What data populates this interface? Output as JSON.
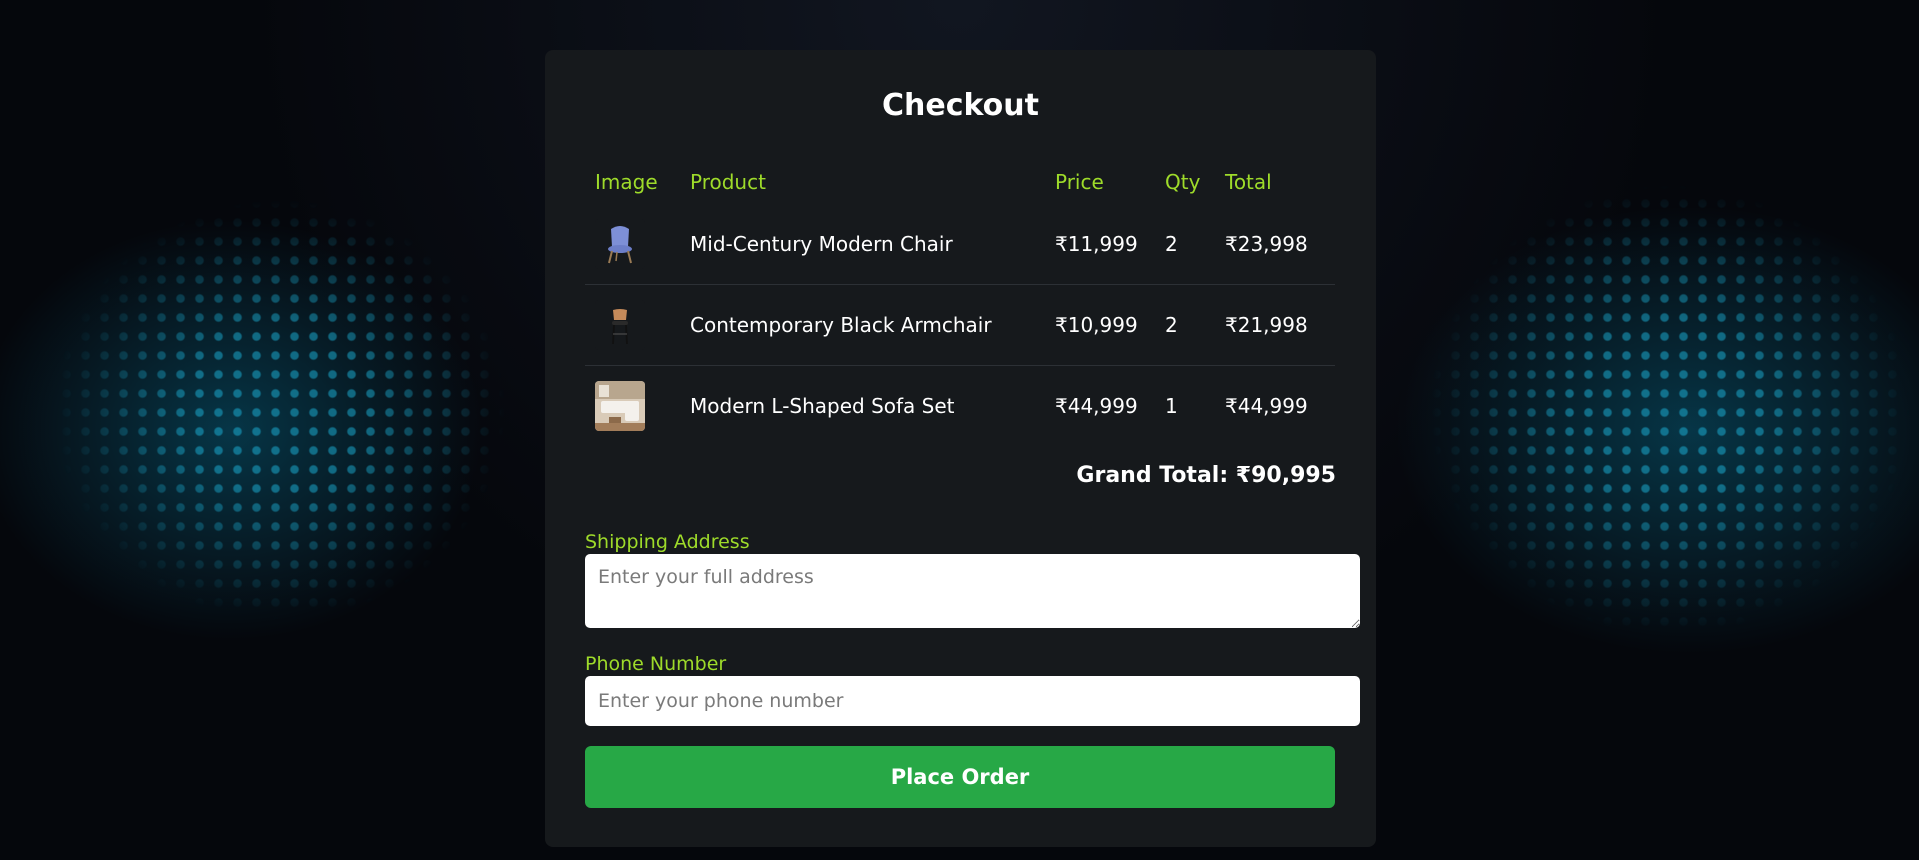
{
  "checkout": {
    "title": "Checkout",
    "table": {
      "headers": [
        "Image",
        "Product",
        "Price",
        "Qty",
        "Total"
      ],
      "rows": [
        {
          "image": "blue-chair-thumbnail",
          "product": "Mid-Century Modern Chair",
          "price": "₹11,999",
          "qty": "2",
          "total": "₹23,998"
        },
        {
          "image": "black-armchair-thumbnail",
          "product": "Contemporary Black Armchair",
          "price": "₹10,999",
          "qty": "2",
          "total": "₹21,998"
        },
        {
          "image": "sofa-set-thumbnail",
          "product": "Modern L-Shaped Sofa Set",
          "price": "₹44,999",
          "qty": "1",
          "total": "₹44,999"
        }
      ]
    },
    "grand_total": "Grand Total: ₹90,995",
    "shipping": {
      "label": "Shipping Address",
      "placeholder": "Enter your full address",
      "value": ""
    },
    "phone": {
      "label": "Phone Number",
      "placeholder": "Enter your phone number",
      "value": ""
    },
    "place_order_label": "Place Order"
  },
  "colors": {
    "accent_label": "#9edb2a",
    "button": "#27a846",
    "card": "#16191c",
    "background": "#05070c"
  }
}
